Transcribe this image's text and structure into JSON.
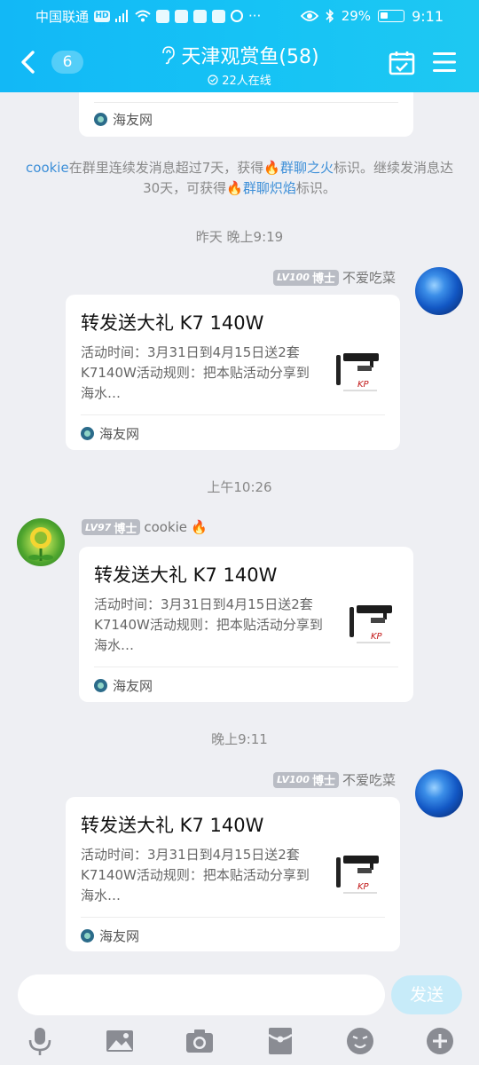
{
  "status_bar": {
    "carrier": "中国联通",
    "network_badges": "HD ⁴ᴳ",
    "battery": "29%",
    "time": "9:11"
  },
  "header": {
    "back_count": "6",
    "title": "天津观赏鱼(58)",
    "online": "22人在线"
  },
  "chat": {
    "top_card_source": "海友网",
    "system_notice": {
      "part1": "cookie",
      "part2": "在群里连续发消息超过7天，获得",
      "part3": "群聊之火",
      "part4": "标识。继续发消息达30天，可获得",
      "part5": "群聊炽焰",
      "part6": "标识。"
    },
    "time1": "昨天 晚上9:19",
    "msg1": {
      "level": "LV100",
      "role": "博士",
      "nickname": "不爱吃菜",
      "card_title": "转发送大礼 K7 140W",
      "card_desc": "活动时间：3月31日到4月15日送2套K7140W活动规则：把本贴活动分享到海水…",
      "source": "海友网"
    },
    "time2": "上午10:26",
    "msg2": {
      "level": "LV97",
      "role": "博士",
      "nickname": "cookie",
      "card_title": "转发送大礼 K7 140W",
      "card_desc": "活动时间：3月31日到4月15日送2套K7140W活动规则：把本贴活动分享到海水…",
      "source": "海友网"
    },
    "time3": "晚上9:11",
    "msg3": {
      "level": "LV100",
      "role": "博士",
      "nickname": "不爱吃菜",
      "card_title": "转发送大礼 K7 140W",
      "card_desc": "活动时间：3月31日到4月15日送2套K7140W活动规则：把本贴活动分享到海水…",
      "source": "海友网"
    }
  },
  "input": {
    "value": "",
    "send_label": "发送"
  },
  "toolbar": {
    "icons": [
      "microphone-icon",
      "image-icon",
      "camera-icon",
      "red-packet-icon",
      "emoji-icon",
      "plus-icon"
    ]
  },
  "colors": {
    "header_gradient_start": "#12b8f6",
    "link": "#3d8fd8",
    "send_button": "#c7ebf9",
    "background": "#eeeff3"
  }
}
